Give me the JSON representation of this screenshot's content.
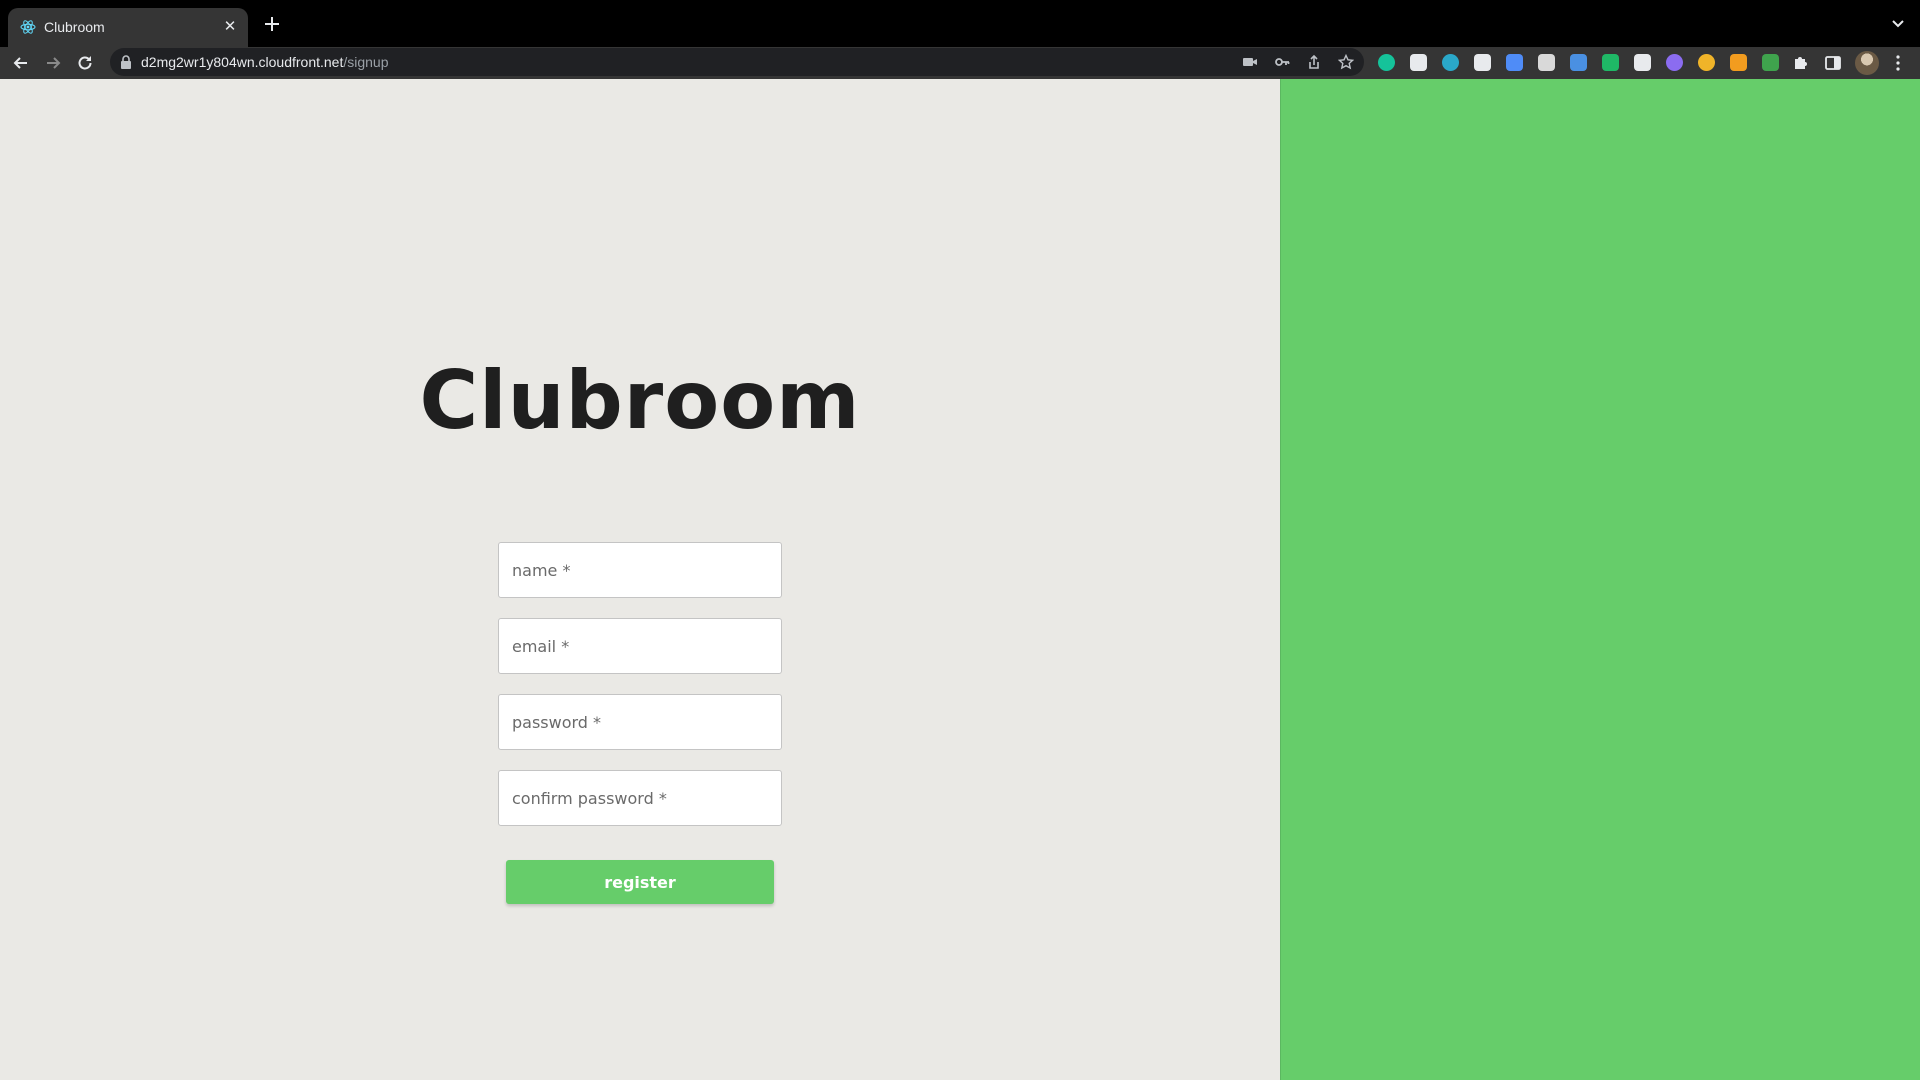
{
  "browser": {
    "tab": {
      "title": "Clubroom",
      "favicon": "react-atom-icon"
    },
    "url": {
      "host": "d2mg2wr1y804wn.cloudfront.net",
      "path": "/signup"
    },
    "extensions": [
      {
        "name": "grammarly-icon",
        "color": "#15c39a"
      },
      {
        "name": "notion-icon",
        "color": "#e8eaed"
      },
      {
        "name": "m-extension-icon",
        "color": "#2aa8c9"
      },
      {
        "name": "cross-extension-icon",
        "color": "#e8eaed"
      },
      {
        "name": "clock-extension-icon",
        "color": "#4f8cf7"
      },
      {
        "name": "envelope-extension-icon",
        "color": "#d9d9d9"
      },
      {
        "name": "image-extension-icon",
        "color": "#4a90e2"
      },
      {
        "name": "green-square-extension-icon",
        "color": "#1fb866"
      },
      {
        "name": "reader-extension-icon",
        "color": "#e8eaed"
      },
      {
        "name": "globe-extension-icon",
        "color": "#8b6cf0"
      },
      {
        "name": "badge-extension-icon",
        "color": "#f0b429"
      },
      {
        "name": "lh-extension-icon",
        "color": "#f29c1f"
      },
      {
        "name": "eyedropper-extension-icon",
        "color": "#3fa34d"
      }
    ]
  },
  "page": {
    "brand": "Clubroom",
    "form": {
      "name_placeholder": "name *",
      "email_placeholder": "email *",
      "password_placeholder": "password *",
      "confirm_placeholder": "confirm password *",
      "submit_label": "register"
    },
    "colors": {
      "accent": "#66cd6a",
      "background": "#eae9e5",
      "text": "#1f1f1f"
    }
  }
}
